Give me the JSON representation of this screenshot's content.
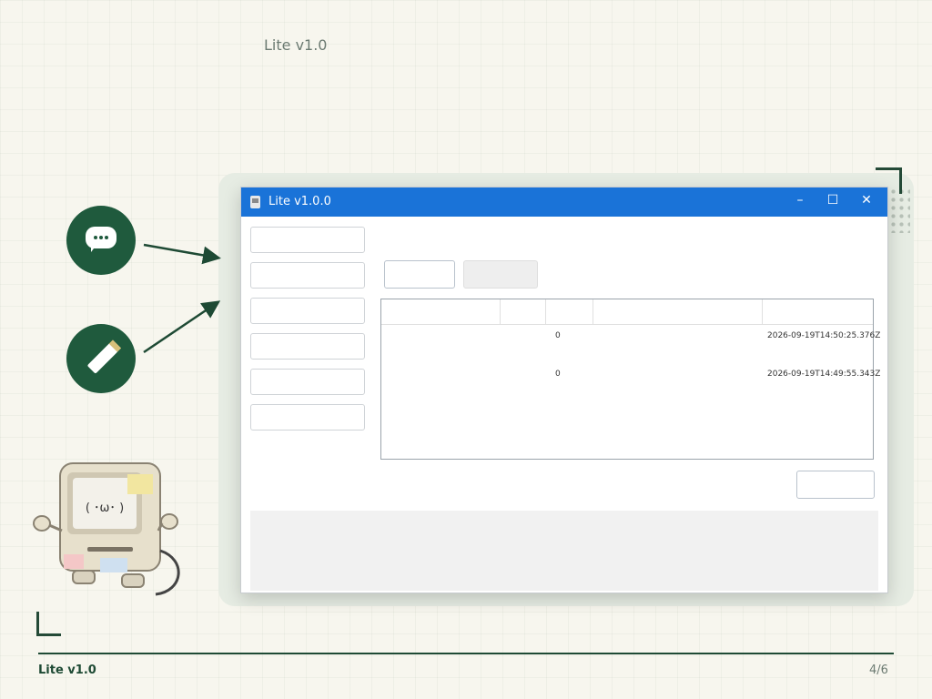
{
  "header": {
    "version": "Lite v1.0"
  },
  "hero": {
    "subtitle": ""
  },
  "window": {
    "title": "Lite v1.0.0",
    "controls": {
      "minimize": "–",
      "maximize": "☐",
      "close": "✕"
    }
  },
  "sidebar": {
    "items": [
      {
        "label": ""
      },
      {
        "label": ""
      },
      {
        "label": ""
      },
      {
        "label": ""
      },
      {
        "label": ""
      },
      {
        "label": ""
      }
    ]
  },
  "main": {
    "heading": "",
    "buttons": {
      "new": "",
      "open": ""
    },
    "table": {
      "columns": [
        {
          "label": ""
        },
        {
          "label": ""
        },
        {
          "label": ""
        },
        {
          "label": ""
        },
        {
          "label": ""
        }
      ],
      "rows": [
        {
          "title": "",
          "status": "",
          "priority": "0",
          "summary": "",
          "summary2": "",
          "updated": "2026-09-19T14:50:25.376Z"
        },
        {
          "title": "",
          "status": "",
          "priority": "0",
          "summary": "",
          "summary2": "",
          "updated": "2026-09-19T14:49:55.343Z"
        }
      ]
    },
    "reload_label": ""
  },
  "footer": {
    "title": "Lite v1.0",
    "page": "4/6"
  },
  "colors": {
    "accent": "#1e4a34",
    "titlebar": "#1a73d8",
    "icon_bg": "#1f5a3d"
  },
  "icons": {
    "chat": "chat-bubble-icon",
    "pen": "pen-icon"
  }
}
